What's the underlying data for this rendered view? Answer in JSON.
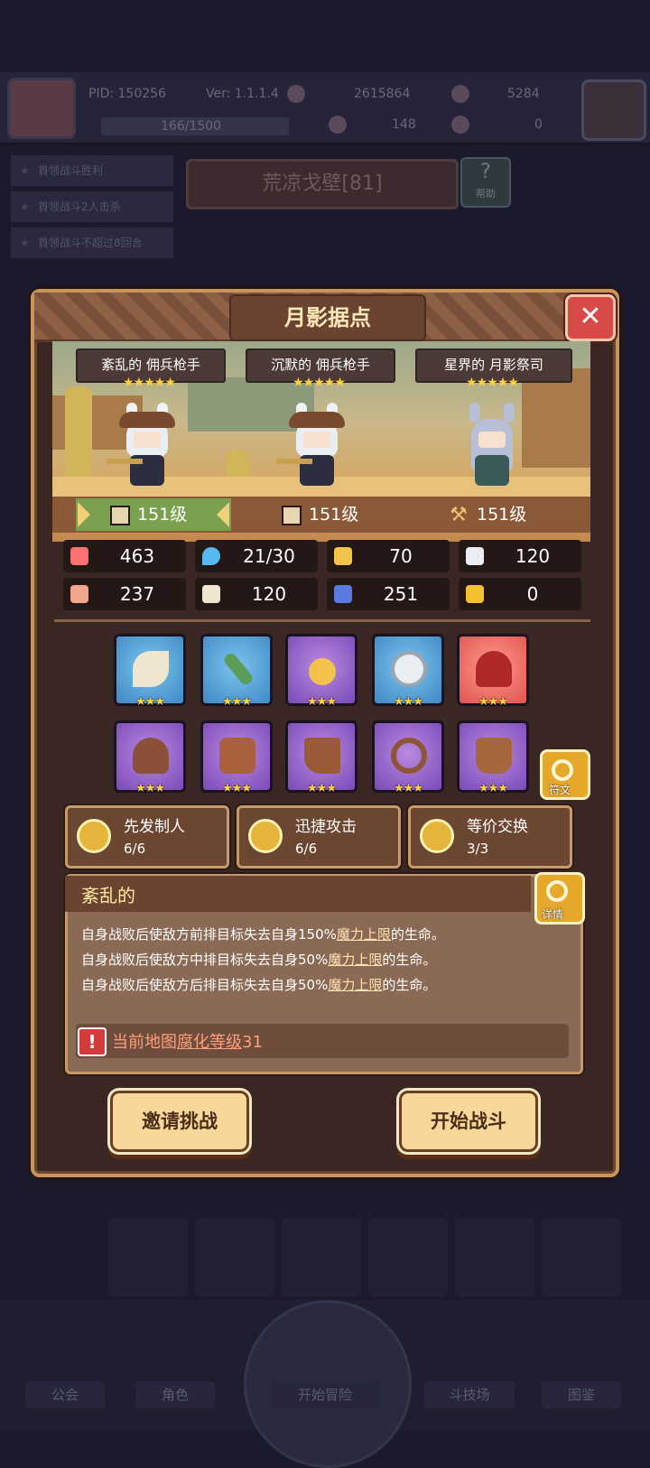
{
  "header": {
    "pid": "PID: 150256",
    "version": "Ver: 1.1.1.4",
    "gold": "2615864",
    "gems": "5284",
    "stamina": "166/1500",
    "clover": "148",
    "keys": "0"
  },
  "side_tasks": [
    "首领战斗胜利",
    "首领战斗2人击杀",
    "首领战斗不超过8回合"
  ],
  "map": {
    "title": "荒凉戈壁[81]",
    "help_label": "帮助"
  },
  "bottom_nav": [
    "公会",
    "角色",
    "开始冒险",
    "斗技场",
    "图鉴"
  ],
  "modal": {
    "title": "月影据点",
    "heroes": [
      {
        "name": "紊乱的 佣兵枪手",
        "stars": "★★★★★",
        "level": "151级"
      },
      {
        "name": "沉默的 佣兵枪手",
        "stars": "★★★★★",
        "level": "151级"
      },
      {
        "name": "星界的 月影祭司",
        "stars": "★★★★★",
        "level": "151级"
      }
    ],
    "stats": [
      {
        "icon": "heart-icon",
        "value": "463",
        "color": "#ff7070"
      },
      {
        "icon": "mana-drop-icon",
        "value": "21/30",
        "color": "#56b8ee"
      },
      {
        "icon": "shield-icon",
        "value": "70",
        "color": "#f2c24a"
      },
      {
        "icon": "wing-icon",
        "value": "120",
        "color": "#e8eef4"
      },
      {
        "icon": "fist-icon",
        "value": "237",
        "color": "#f2a58a"
      },
      {
        "icon": "book-icon",
        "value": "120",
        "color": "#f0e6d0"
      },
      {
        "icon": "flag-icon",
        "value": "251",
        "color": "#5a7ae0"
      },
      {
        "icon": "horseshoe-icon",
        "value": "0",
        "color": "#f2c030"
      }
    ],
    "equipment": [
      {
        "name": "bow-icon",
        "stars": "★★★",
        "rarity": "blue",
        "color": "#efe6d0"
      },
      {
        "name": "arrow-icon",
        "stars": "★★★",
        "rarity": "blue",
        "color": "#5a9c5a"
      },
      {
        "name": "amulet-icon",
        "stars": "★★★",
        "rarity": "purple",
        "color": "#f2c24a"
      },
      {
        "name": "gem-ring-icon",
        "stars": "★★★",
        "rarity": "blue",
        "color": "#e8eef2"
      },
      {
        "name": "helmet-icon",
        "stars": "★★★",
        "rarity": "red",
        "color": "#b02828"
      },
      {
        "name": "shoulder-pad-icon",
        "stars": "★★★",
        "rarity": "purple",
        "color": "#8a5038"
      },
      {
        "name": "armor-icon",
        "stars": "★★★",
        "rarity": "purple",
        "color": "#a8603e"
      },
      {
        "name": "greave-icon",
        "stars": "★★★",
        "rarity": "purple",
        "color": "#9a5a3a"
      },
      {
        "name": "belt-icon",
        "stars": "★★★",
        "rarity": "purple",
        "color": "#8e5436"
      },
      {
        "name": "boots-icon",
        "stars": "★★★",
        "rarity": "purple",
        "color": "#a6663e"
      }
    ],
    "rune_label": "符文",
    "skills": [
      {
        "name": "先发制人",
        "count": "6/6"
      },
      {
        "name": "迅捷攻击",
        "count": "6/6"
      },
      {
        "name": "等价交换",
        "count": "3/3"
      }
    ],
    "description": {
      "title": "紊乱的",
      "detail_label": "详情",
      "lines": [
        {
          "before": "自身战败后使敌方前排目标失去自身150%",
          "link": "魔力上限",
          "after": "的生命。"
        },
        {
          "before": "自身战败后使敌方中排目标失去自身50%",
          "link": "魔力上限",
          "after": "的生命。"
        },
        {
          "before": "自身战败后使敌方后排目标失去自身50%",
          "link": "魔力上限",
          "after": "的生命。"
        }
      ],
      "warning": {
        "before": "当前地图",
        "link": "腐化等级",
        "after": "31"
      }
    },
    "buttons": {
      "invite": "邀请挑战",
      "start": "开始战斗"
    }
  }
}
